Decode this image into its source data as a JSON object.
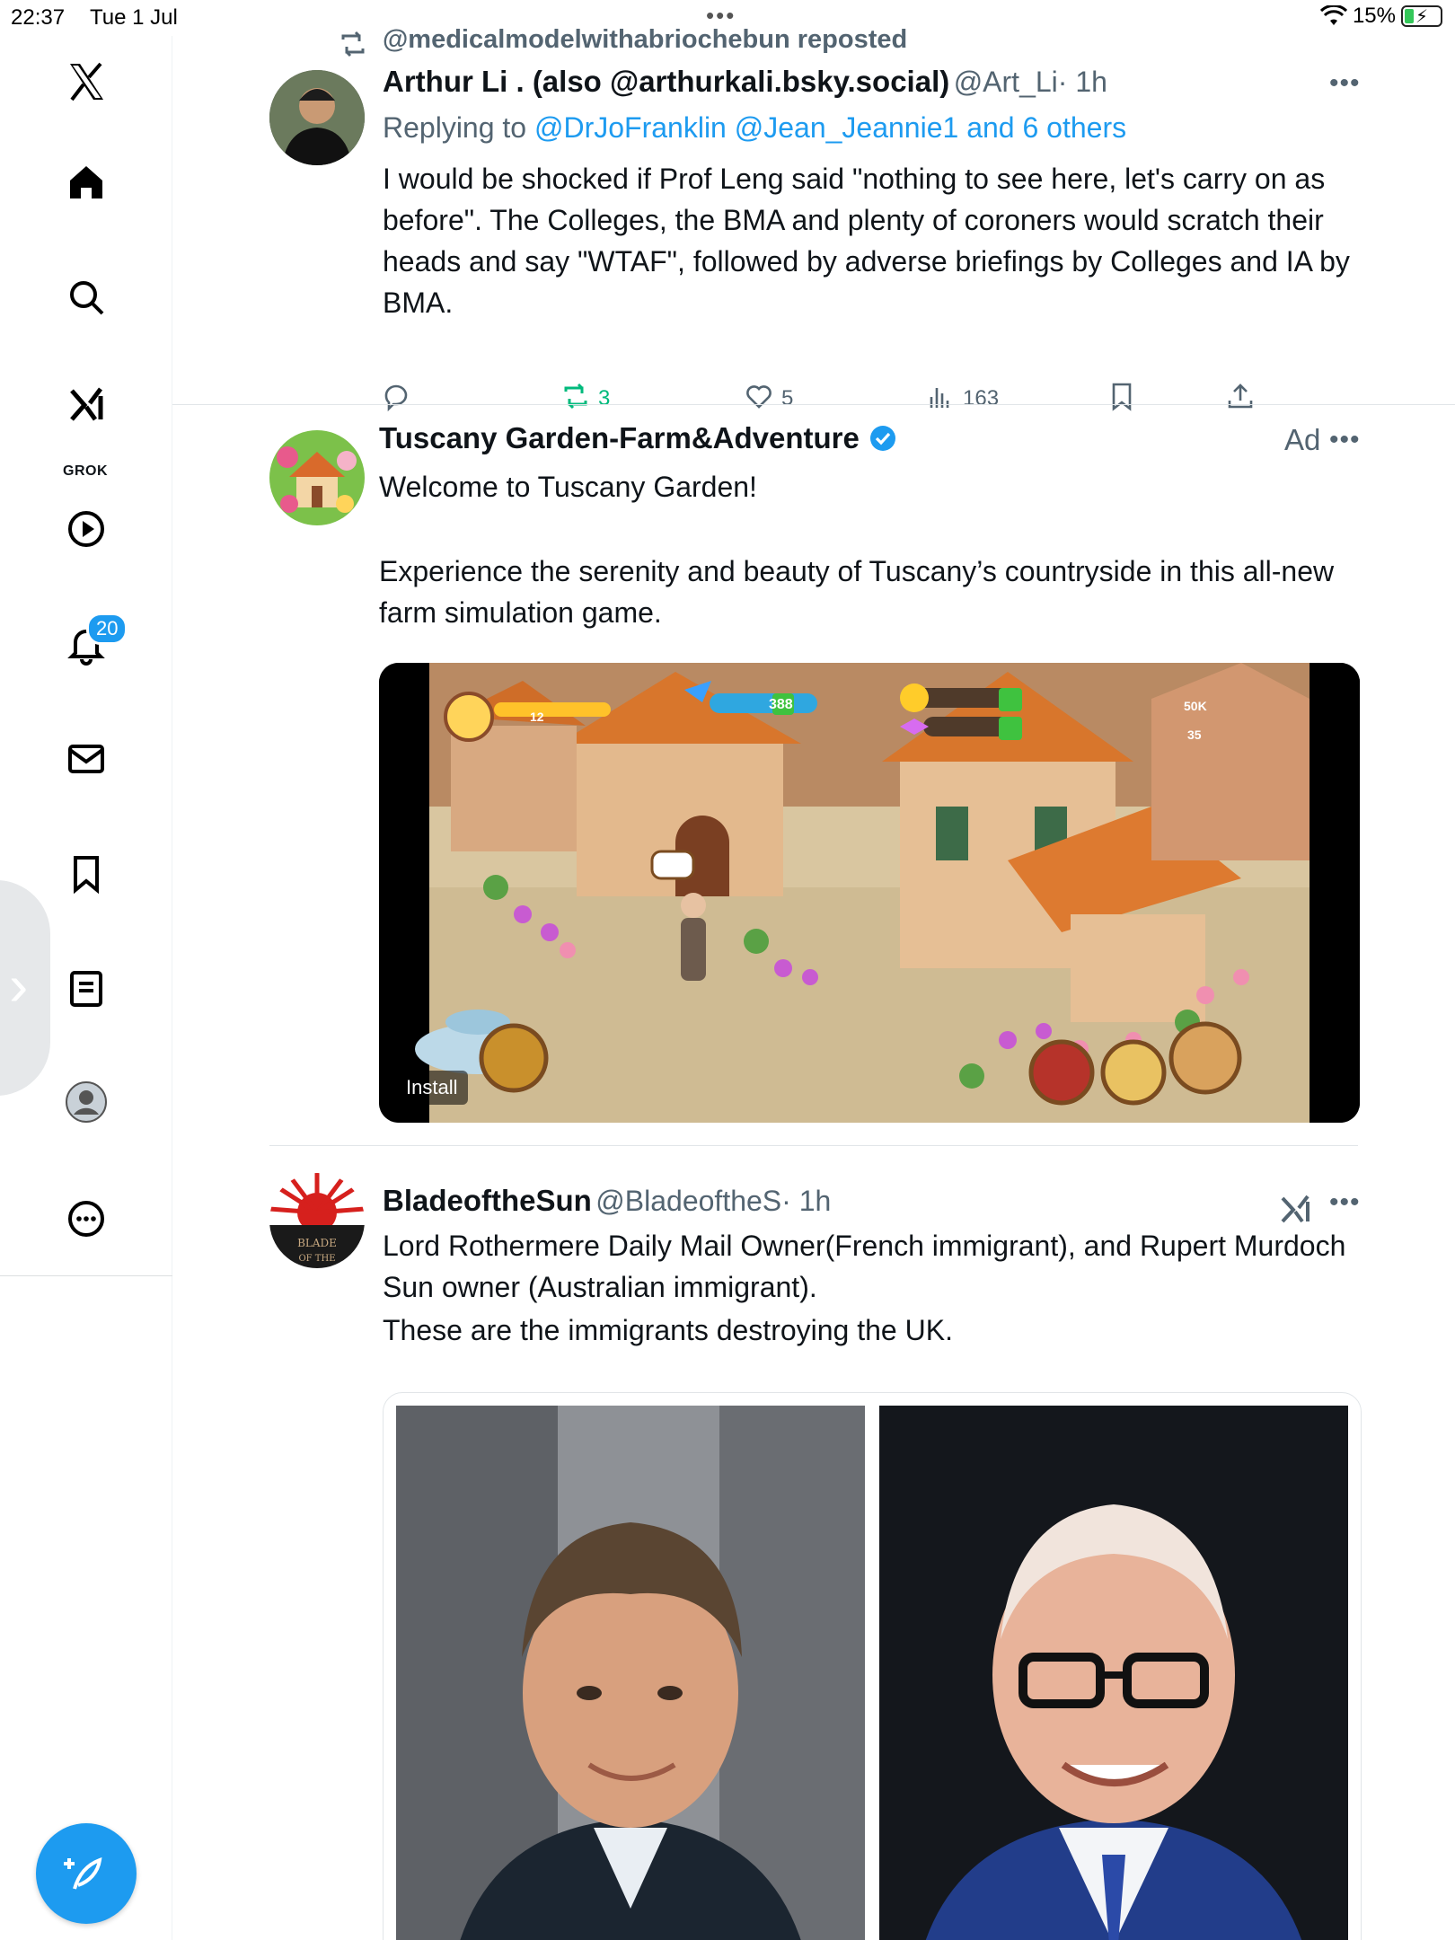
{
  "status_bar": {
    "time": "22:37",
    "date": "Tue 1 Jul",
    "battery": "15%"
  },
  "sidebar": {
    "grok_label": "GROK",
    "notifications_badge": "20"
  },
  "post1": {
    "repost_line": "@medicalmodelwithabriochebun reposted",
    "author_name": "Arthur Li . (also @arthurkali.bsky.social)",
    "author_handle": "@Art_Li",
    "time": "· 1h",
    "replying_to_prefix": "Replying to ",
    "replying_to_links": "@DrJoFranklin @Jean_Jeannie1 and 6 others",
    "text": "I would be shocked if Prof Leng said \"nothing to see here, let's carry on as before\". The Colleges, the BMA and plenty of coroners would scratch their heads and say \"WTAF\", followed by adverse briefings by Colleges and IA by BMA.",
    "reposts": "3",
    "likes": "5",
    "views": "163"
  },
  "post2": {
    "author_name": "Tuscany Garden-Farm&Adventure",
    "ad_label": "Ad",
    "text1": "Welcome to Tuscany Garden!",
    "text2": "Experience the serenity and beauty of Tuscany’s countryside in this all-new farm simulation game.",
    "install_label": "Install",
    "game_hud": {
      "energy": "388",
      "coins": "50K",
      "gems": "35",
      "level": "12"
    }
  },
  "post3": {
    "author_name": "BladeoftheSun",
    "author_handle": "@BladeoftheS",
    "time": "· 1h",
    "text1": "Lord Rothermere Daily Mail Owner(French immigrant), and Rupert Murdoch Sun owner (Australian immigrant).",
    "text2": "These are the immigrants destroying the UK."
  },
  "colors": {
    "accent": "#1d9bf0",
    "repost_green": "#00ba7c",
    "muted": "#536471"
  }
}
